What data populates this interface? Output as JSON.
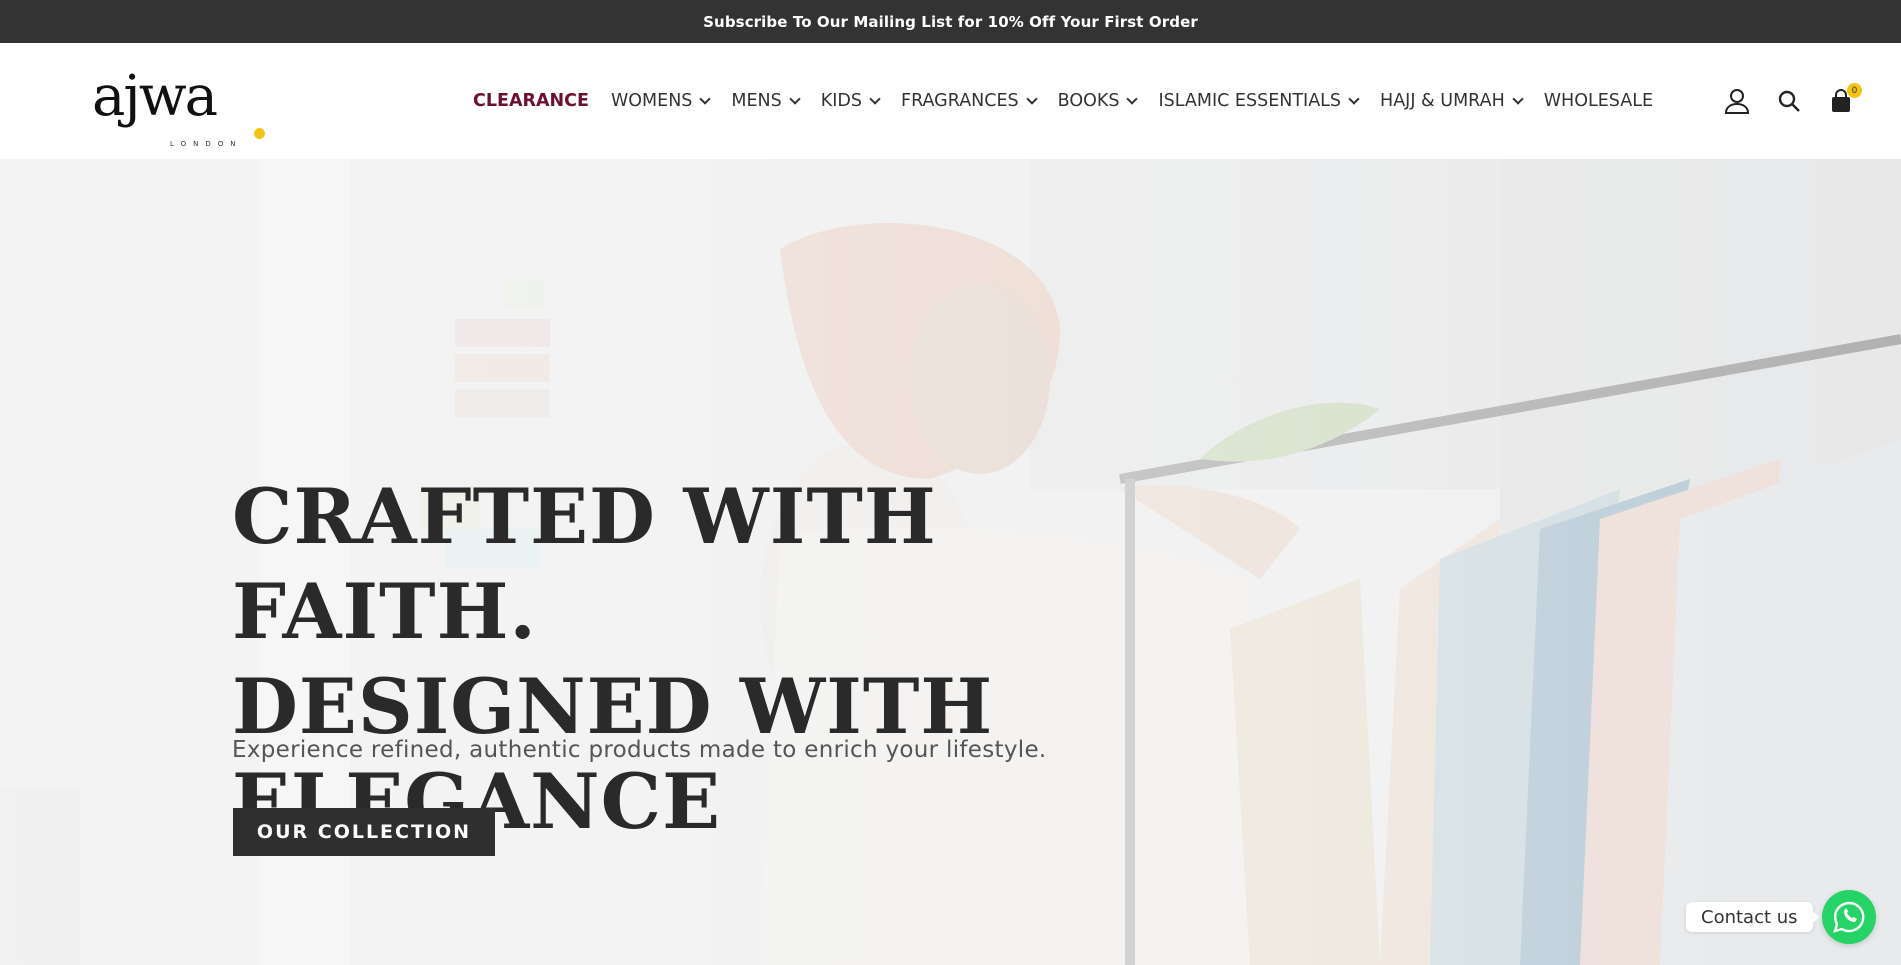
{
  "announcement": {
    "text": "Subscribe To Our Mailing List for 10% Off Your First Order"
  },
  "logo": {
    "word": "ajwa",
    "sub": "LONDON",
    "accent_color": "#f2c515"
  },
  "nav": {
    "items": [
      {
        "label": "CLEARANCE",
        "dropdown": false
      },
      {
        "label": "WOMENS",
        "dropdown": true
      },
      {
        "label": "MENS",
        "dropdown": true
      },
      {
        "label": "KIDS",
        "dropdown": true
      },
      {
        "label": "FRAGRANCES",
        "dropdown": true
      },
      {
        "label": "BOOKS",
        "dropdown": true
      },
      {
        "label": "ISLAMIC ESSENTIALS",
        "dropdown": true
      },
      {
        "label": "HAJJ & UMRAH",
        "dropdown": true
      },
      {
        "label": "WHOLESALE",
        "dropdown": false
      }
    ],
    "highlight_color": "#6b1033"
  },
  "header_icons": {
    "account": "user-icon",
    "search": "search-icon",
    "cart": "cart-icon",
    "cart_count": "0"
  },
  "hero": {
    "title_lines": [
      "CRAFTED WITH FAITH.",
      "DESIGNED WITH",
      "ELEGANCE"
    ],
    "subtitle": "Experience refined, authentic products made to enrich your lifestyle.",
    "cta_label": "OUR COLLECTION"
  },
  "contact": {
    "label": "Contact us",
    "icon": "whatsapp-icon",
    "color": "#25d366"
  }
}
